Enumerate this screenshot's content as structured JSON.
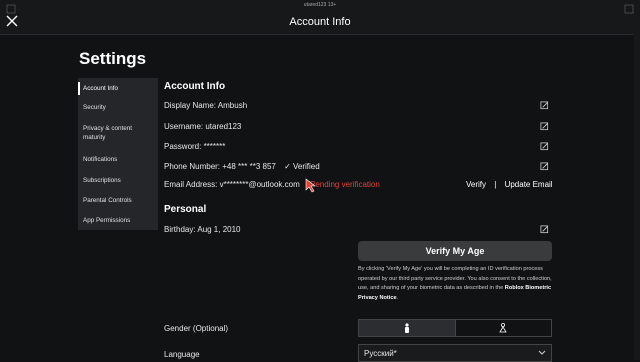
{
  "window": {
    "username": "utared123 13+",
    "title": "Account Info"
  },
  "page_title": "Settings",
  "sidebar": {
    "items": [
      {
        "label": "Account Info",
        "active": true
      },
      {
        "label": "Security"
      },
      {
        "label": "Privacy & content maturity"
      },
      {
        "label": "Notifications"
      },
      {
        "label": "Subscriptions"
      },
      {
        "label": "Parental Controls"
      },
      {
        "label": "App Permissions"
      }
    ]
  },
  "account": {
    "heading": "Account Info",
    "display_name": "Display Name: Ambush",
    "username": "Username: utared123",
    "password": "Password: *******",
    "phone": "Phone Number: +48 *** **3 857",
    "phone_verified": "✓ Verified",
    "email": "Email Address: v********@outlook.com",
    "email_status": "Pending verification",
    "verify_link": "Verify",
    "separator": "|",
    "update_email_link": "Update Email"
  },
  "personal": {
    "heading": "Personal",
    "birthday": "Birthday: Aug 1, 2010",
    "verify_age_button": "Verify My Age",
    "consent_text": "By clicking 'Verify My Age' you will be completing an ID verification process operated by our third party service provider. You also consent to the collection, use, and sharing of your biometric data as described in the",
    "consent_link": "Roblox Biometric Privacy Notice",
    "consent_end": ".",
    "gender_label": "Gender (Optional)",
    "language_label": "Language",
    "language_value": "Русский*"
  },
  "colors": {
    "background": "#111214",
    "sidebar": "#25262a",
    "pending": "#e0443a",
    "button": "#393b3d"
  },
  "icons": [
    "close-icon",
    "edit-icon",
    "male-icon",
    "female-icon",
    "chevron-down-icon"
  ]
}
